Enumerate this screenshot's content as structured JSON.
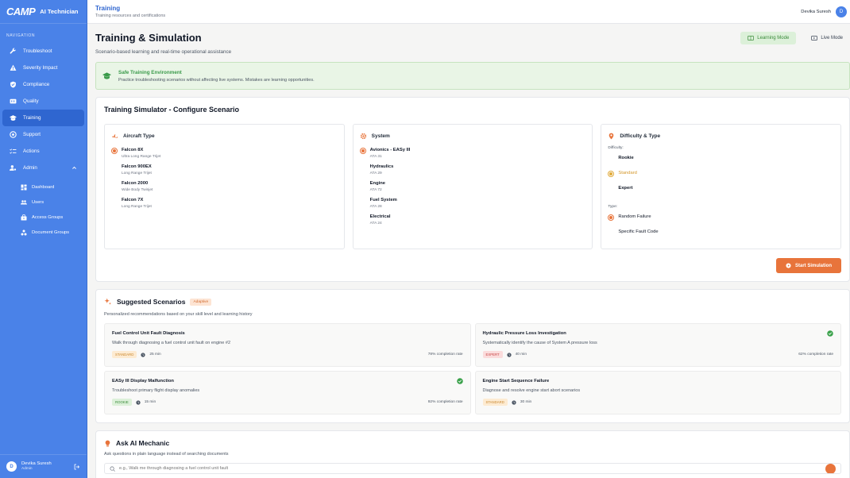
{
  "sidebar": {
    "brand_logo": "CAMP",
    "brand_name": "AI Technician",
    "nav_heading": "NAVIGATION",
    "items": [
      {
        "label": "Troubleshoot",
        "icon": "wrench-icon"
      },
      {
        "label": "Severity Impact",
        "icon": "warning-icon"
      },
      {
        "label": "Compliance",
        "icon": "shield-check-icon"
      },
      {
        "label": "Quality",
        "icon": "quality-icon"
      },
      {
        "label": "Training",
        "icon": "graduation-cap-icon"
      },
      {
        "label": "Support",
        "icon": "support-icon"
      },
      {
        "label": "Actions",
        "icon": "checklist-icon"
      },
      {
        "label": "Admin",
        "icon": "admin-gear-icon"
      }
    ],
    "active": "Training",
    "admin_sub": [
      {
        "label": "Dashboard",
        "icon": "dashboard-icon"
      },
      {
        "label": "Users",
        "icon": "users-icon"
      },
      {
        "label": "Access Groups",
        "icon": "access-groups-icon"
      },
      {
        "label": "Document Groups",
        "icon": "document-groups-icon"
      }
    ],
    "footer": {
      "avatar": "D",
      "name": "Devika Suresh",
      "role": "Admin"
    }
  },
  "topbar": {
    "title": "Training",
    "subtitle": "Training resources and certifications",
    "user_name": "Devika Suresh",
    "user_avatar": "D"
  },
  "page": {
    "title": "Training & Simulation",
    "subtitle": "Scenario-based learning and real-time operational assistance",
    "modes": {
      "learning": "Learning Mode",
      "live": "Live Mode"
    }
  },
  "banner": {
    "title": "Safe Training Environment",
    "text": "Practice troubleshooting scenarios without affecting live systems. Mistakes are learning opportunities."
  },
  "simulator": {
    "title": "Training Simulator - Configure Scenario",
    "aircraft": {
      "heading": "Aircraft Type",
      "options": [
        {
          "name": "Falcon 8X",
          "desc": "Ultra Long Range Trijet",
          "selected": true
        },
        {
          "name": "Falcon 900EX",
          "desc": "Long Range Trijet",
          "selected": false
        },
        {
          "name": "Falcon 2000",
          "desc": "Wide Body Twinjet",
          "selected": false
        },
        {
          "name": "Falcon 7X",
          "desc": "Long Range Trijet",
          "selected": false
        }
      ]
    },
    "system": {
      "heading": "System",
      "options": [
        {
          "name": "Avionics - EASy III",
          "desc": "ATA 31",
          "selected": true
        },
        {
          "name": "Hydraulics",
          "desc": "ATA 29",
          "selected": false
        },
        {
          "name": "Engine",
          "desc": "ATA 72",
          "selected": false
        },
        {
          "name": "Fuel System",
          "desc": "ATA 28",
          "selected": false
        },
        {
          "name": "Electrical",
          "desc": "ATA 24",
          "selected": false
        }
      ]
    },
    "difficulty": {
      "heading": "Difficulty & Type",
      "difficulty_label": "Difficulty:",
      "levels": [
        "Rookie",
        "Standard",
        "Expert"
      ],
      "selected_level": "Standard",
      "type_label": "Type:",
      "types": [
        "Random Failure",
        "Specific Fault Code"
      ],
      "selected_type": "Random Failure"
    },
    "start_label": "Start Simulation"
  },
  "suggested": {
    "title": "Suggested Scenarios",
    "badge": "Adaptive",
    "subtitle": "Personalized recommendations based on your skill level and learning history",
    "scenarios": [
      {
        "title": "Fuel Control Unit Fault Diagnosis",
        "desc": "Walk through diagnosing a fuel control unit fault on engine #2",
        "level": "STANDARD",
        "level_class": "standard",
        "time": "25 min",
        "rate": "78% completion rate",
        "done": false
      },
      {
        "title": "Hydraulic Pressure Loss Investigation",
        "desc": "Systematically identify the cause of System A pressure loss",
        "level": "EXPERT",
        "level_class": "expert",
        "time": "40 min",
        "rate": "62% completion rate",
        "done": true
      },
      {
        "title": "EASy III Display Malfunction",
        "desc": "Troubleshoot primary flight display anomalies",
        "level": "ROOKIE",
        "level_class": "rookie",
        "time": "15 min",
        "rate": "92% completion rate",
        "done": true
      },
      {
        "title": "Engine Start Sequence Failure",
        "desc": "Diagnose and resolve engine start abort scenarios",
        "level": "STANDARD",
        "level_class": "standard",
        "time": "30 min",
        "rate": "",
        "done": false
      }
    ]
  },
  "ask": {
    "title": "Ask AI Mechanic",
    "subtitle": "Ask questions in plain language instead of searching documents",
    "placeholder": "e.g., Walk me through diagnosing a fuel control unit fault"
  },
  "colors": {
    "sidebar": "#4a82e8",
    "accent": "#e8743b",
    "learning_green": "#3a8a3a"
  }
}
